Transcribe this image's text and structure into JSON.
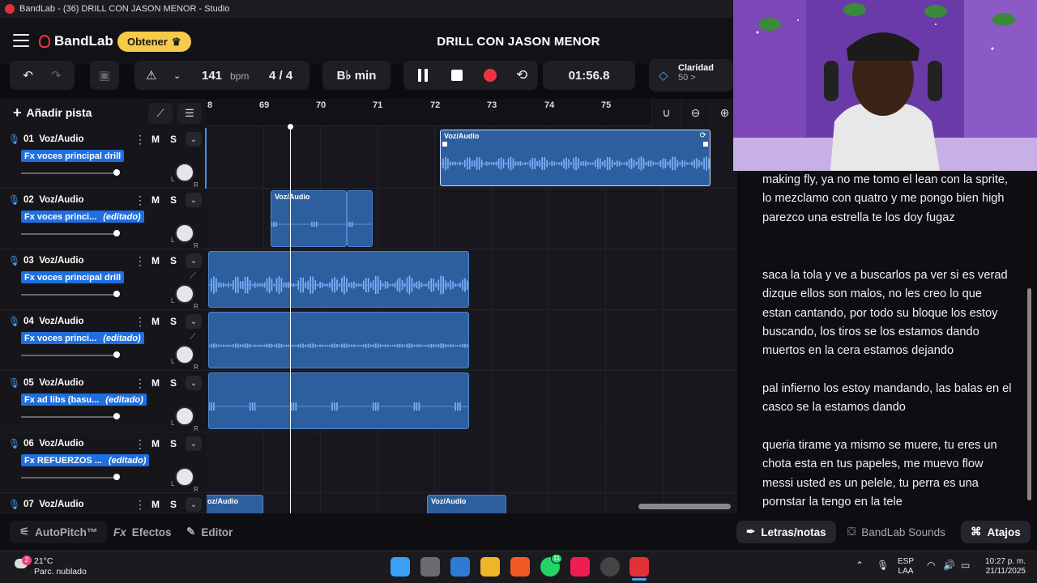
{
  "window": {
    "title": "BandLab - (36) DRILL CON JASON MENOR - Studio"
  },
  "header": {
    "brand": "BandLab",
    "obtener_label": "Obtener",
    "song_title": "DRILL CON JASON MENOR"
  },
  "transport": {
    "bpm": "141",
    "bpm_unit": "bpm",
    "time_signature": "4 / 4",
    "key": "B♭ min",
    "time": "01:56.8",
    "claridad_label": "Claridad",
    "claridad_value": "50 >"
  },
  "sidebar": {
    "add_track_label": "Añadir pista"
  },
  "tracks": [
    {
      "num": "01",
      "name": "Voz/Audio",
      "fx": "Fx voces principal drill",
      "edited": ""
    },
    {
      "num": "02",
      "name": "Voz/Audio",
      "fx": "Fx voces princi...",
      "edited": "(editado)"
    },
    {
      "num": "03",
      "name": "Voz/Audio",
      "fx": "Fx voces principal drill",
      "edited": ""
    },
    {
      "num": "04",
      "name": "Voz/Audio",
      "fx": "Fx voces princi...",
      "edited": "(editado)"
    },
    {
      "num": "05",
      "name": "Voz/Audio",
      "fx": "Fx ad libs (basu...",
      "edited": "(editado)"
    },
    {
      "num": "06",
      "name": "Voz/Audio",
      "fx": "Fx REFUERZOS ...",
      "edited": "(editado)"
    },
    {
      "num": "07",
      "name": "Voz/Audio",
      "fx": "",
      "edited": ""
    }
  ],
  "track_controls": {
    "mute": "M",
    "solo": "S",
    "pan_left": "L",
    "pan_right": "R"
  },
  "ruler": {
    "ticks": [
      "8",
      "69",
      "70",
      "71",
      "72",
      "73",
      "74",
      "75"
    ]
  },
  "clips": {
    "label": "Voz/Audio",
    "label_cut": "oz/Audio"
  },
  "lyrics": {
    "paragraphs": [
      "making fly, ya no me tomo el lean con la sprite, lo mezclamo con quatro y me pongo bien high parezco una estrella te los doy fugaz",
      "saca la tola y ve a buscarlos pa ver si es verad dizque ellos son malos, no les creo lo que estan cantando, por todo su bloque los estoy buscando, los tiros se los estamos dando muertos en la cera estamos dejando",
      "pal infierno los estoy mandando, las balas en el casco se la estamos dando",
      "queria tirame ya mismo se muere, tu eres un chota esta en tus papeles, me muevo flow messi usted es un pelele, tu perra es una pornstar la tengo en la tele"
    ]
  },
  "bottombar": {
    "autopitch": "AutoPitch™",
    "efectos": "Efectos",
    "editor": "Editor",
    "letras": "Letras/notas",
    "sounds": "BandLab Sounds",
    "atajos": "Atajos"
  },
  "taskbar": {
    "weather_temp": "21°C",
    "weather_desc": "Parc. nublado",
    "weather_badge": "2",
    "lang_top": "ESP",
    "lang_bottom": "LAA",
    "clock_time": "10:27 p. m.",
    "clock_date": "21/11/2025",
    "whatsapp_badge": "11"
  },
  "colors": {
    "accent": "#1f6fe0",
    "clip": "#2d5f9e",
    "record": "#f2323e",
    "obtener": "#f7c948"
  }
}
